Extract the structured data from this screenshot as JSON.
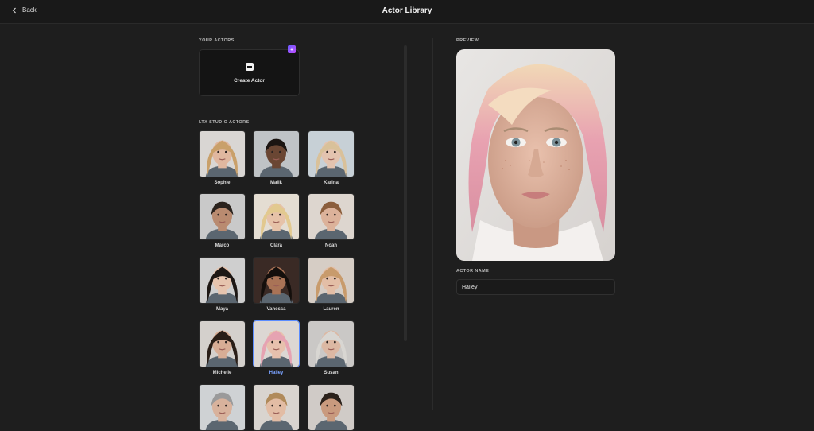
{
  "header": {
    "back_label": "Back",
    "title": "Actor Library"
  },
  "your_actors": {
    "section_label": "YOUR ACTORS",
    "create_label": "Create Actor"
  },
  "studio_actors": {
    "section_label": "LTX STUDIO ACTORS",
    "actors": [
      {
        "name": "Sophie"
      },
      {
        "name": "Malik"
      },
      {
        "name": "Karina"
      },
      {
        "name": "Marco"
      },
      {
        "name": "Clara"
      },
      {
        "name": "Noah"
      },
      {
        "name": "Maya"
      },
      {
        "name": "Vanessa"
      },
      {
        "name": "Lauren"
      },
      {
        "name": "Michelle"
      },
      {
        "name": "Hailey"
      },
      {
        "name": "Susan"
      }
    ],
    "selected": "Hailey"
  },
  "preview": {
    "section_label": "PREVIEW",
    "field_label": "ACTOR NAME",
    "actor_name": "Hailey"
  },
  "colors": {
    "accent": "#5b8cff",
    "background": "#1e1e1e"
  }
}
